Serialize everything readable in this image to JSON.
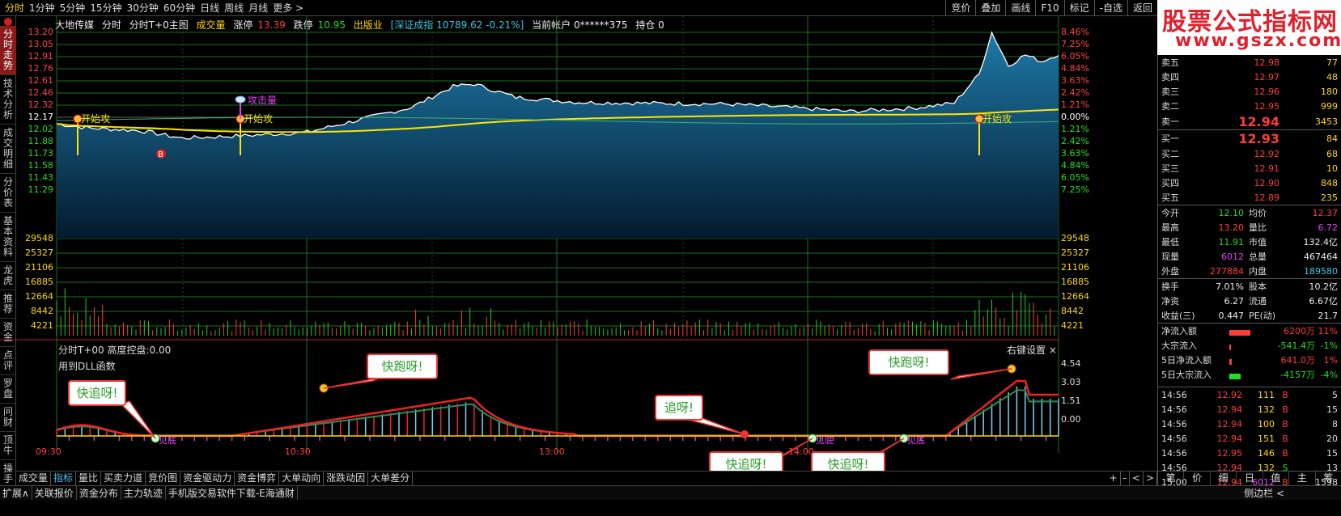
{
  "topbar": {
    "tabs": [
      "分时",
      "1分钟",
      "5分钟",
      "15分钟",
      "30分钟",
      "60分钟",
      "日线",
      "周线",
      "月线",
      "更多 >"
    ],
    "right_buttons": [
      "竞价",
      "叠加",
      "画线",
      "F10",
      "标记",
      "-自选",
      "返回"
    ]
  },
  "brand": {
    "line1": "股票公式指标网",
    "line2": "www.gszx.com.cn"
  },
  "sidebar": {
    "items": [
      "分时走势",
      "技术分析",
      "成交明细",
      "分价表",
      "基本资料",
      "龙虎",
      "推荐",
      "资金",
      "点评",
      "罗盘",
      "问财",
      "顶牛",
      "操手"
    ]
  },
  "info": {
    "stock_name": "大地传媒",
    "mode": "分时",
    "t0": "分时T+0主图",
    "vol": "成交量",
    "limit_up_label": "涨停",
    "limit_up": "13.39",
    "limit_down_label": "跌停",
    "limit_down": "10.95",
    "sector": "出版业",
    "index": "[深证成指 10789.62 -0.21%]",
    "account": "当前帐户 0******375",
    "holding": "持仓 0"
  },
  "price_axis_left": [
    "13.20",
    "13.05",
    "12.91",
    "12.76",
    "12.61",
    "12.46",
    "12.32",
    "12.17",
    "12.02",
    "11.88",
    "11.73",
    "11.58",
    "11.43",
    "11.29"
  ],
  "price_axis_right": [
    "8.46%",
    "7.25%",
    "6.05%",
    "4.84%",
    "3.63%",
    "2.42%",
    "1.21%",
    "0.00%",
    "1.21%",
    "2.42%",
    "3.63%",
    "4.84%",
    "6.05%",
    "7.25%"
  ],
  "vol_axis": [
    "29548",
    "25327",
    "21106",
    "16885",
    "12664",
    "8442",
    "4221"
  ],
  "osc_axis": [
    "4.54",
    "3.03",
    "1.51",
    "0.00"
  ],
  "time_axis": [
    "09:30",
    "10:30",
    "13:00",
    "14:00"
  ],
  "annotations": {
    "start_attack": "开始攻",
    "attack_vol": "攻击量",
    "buy": "B",
    "bottom": "见底"
  },
  "callouts": [
    "快追呀!",
    "快跑呀!",
    "追呀!",
    "快追呀!",
    "快追呀!",
    "快跑呀!"
  ],
  "subchart": {
    "title": "分时T+00",
    "height_label": "高度控盘:",
    "height_val": "0.00",
    "dll": "用到DLL函数",
    "settings": "右键设置"
  },
  "bottom_tabs": [
    "成交量",
    "指标",
    "量比",
    "买卖力道",
    "竞价图",
    "资金驱动力",
    "资金博弈",
    "大单动向",
    "涨跌动因",
    "大单差分"
  ],
  "bottom_right": [
    "+",
    "-",
    "<",
    ">"
  ],
  "status_bar": [
    "扩展∧",
    "关联报价",
    "资金分布",
    "主力轨迹",
    "手机版交易软件下载-E海通财"
  ],
  "status_right": "侧边栏 <",
  "orderbook": {
    "sell": [
      {
        "label": "卖五",
        "price": "12.98",
        "vol": "77"
      },
      {
        "label": "卖四",
        "price": "12.97",
        "vol": "48"
      },
      {
        "label": "卖三",
        "price": "12.96",
        "vol": "180"
      },
      {
        "label": "卖二",
        "price": "12.95",
        "vol": "999"
      },
      {
        "label": "卖一",
        "price": "12.94",
        "vol": "3453"
      }
    ],
    "buy": [
      {
        "label": "买一",
        "price": "12.93",
        "vol": "84"
      },
      {
        "label": "买二",
        "price": "12.92",
        "vol": "68"
      },
      {
        "label": "买三",
        "price": "12.91",
        "vol": "10"
      },
      {
        "label": "买四",
        "price": "12.90",
        "vol": "848"
      },
      {
        "label": "买五",
        "price": "12.89",
        "vol": "235"
      }
    ]
  },
  "quote": [
    {
      "k1": "今开",
      "v1": "12.10",
      "c1": "green",
      "k2": "均价",
      "v2": "12.37",
      "c2": "red"
    },
    {
      "k1": "最高",
      "v1": "13.20",
      "c1": "red",
      "k2": "量比",
      "v2": "6.72",
      "c2": "purple"
    },
    {
      "k1": "最低",
      "v1": "11.91",
      "c1": "green",
      "k2": "市值",
      "v2": "132.4亿",
      "c2": "white"
    },
    {
      "k1": "现量",
      "v1": "6012",
      "c1": "purple",
      "k2": "总量",
      "v2": "467464",
      "c2": "white"
    },
    {
      "k1": "外盘",
      "v1": "277884",
      "c1": "red",
      "k2": "内盘",
      "v2": "189580",
      "c2": "cyan"
    },
    {
      "k1": "换手",
      "v1": "7.01%",
      "c1": "white",
      "k2": "股本",
      "v2": "10.2亿",
      "c2": "white"
    },
    {
      "k1": "净资",
      "v1": "6.27",
      "c1": "white",
      "k2": "流通",
      "v2": "6.67亿",
      "c2": "white"
    },
    {
      "k1": "收益(三)",
      "v1": "0.447",
      "c1": "white",
      "k2": "PE(动)",
      "v2": "21.7",
      "c2": "white"
    }
  ],
  "flows": [
    {
      "k": "净流入额",
      "v": "6200万",
      "p": "11%",
      "color": "red",
      "bar": "#ff3b3b"
    },
    {
      "k": "大宗流入",
      "v": "-541.4万",
      "p": "-1%",
      "color": "green",
      "bar": "#ff3b3b"
    },
    {
      "k": "5日净流入额",
      "v": "641.0万",
      "p": "1%",
      "color": "red",
      "bar": "#ff3b3b"
    },
    {
      "k": "5日大宗流入",
      "v": "-4157万",
      "p": "-4%",
      "color": "green",
      "bar": "#22dd22"
    }
  ],
  "ticks": [
    {
      "t": "14:56",
      "p": "12.92",
      "v": "111",
      "d": "B",
      "n": "5"
    },
    {
      "t": "14:56",
      "p": "12.94",
      "v": "132",
      "d": "B",
      "n": "15"
    },
    {
      "t": "14:56",
      "p": "12.94",
      "v": "100",
      "d": "B",
      "n": "8"
    },
    {
      "t": "14:56",
      "p": "12.94",
      "v": "151",
      "d": "B",
      "n": "20"
    },
    {
      "t": "14:56",
      "p": "12.95",
      "v": "146",
      "d": "B",
      "n": "15"
    },
    {
      "t": "14:56",
      "p": "12.94",
      "v": "132",
      "d": "S",
      "n": "13"
    },
    {
      "t": "15:00",
      "p": "12.94",
      "v": "6012",
      "d": "B",
      "n": "1598"
    }
  ],
  "panel_tabs": [
    "笔",
    "价",
    "细",
    "日",
    "值",
    "主",
    "筹"
  ]
}
